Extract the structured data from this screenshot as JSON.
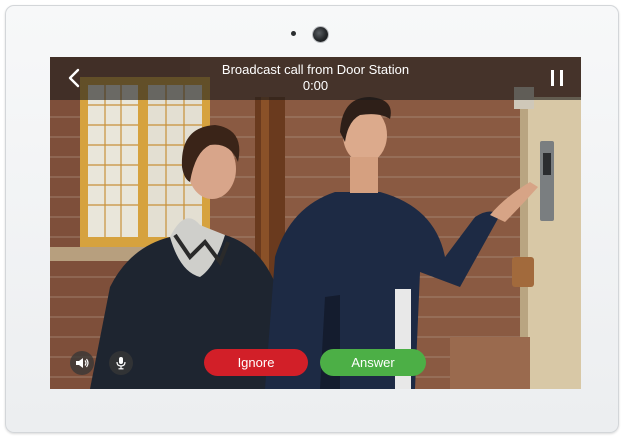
{
  "call": {
    "title": "Broadcast call from Door Station",
    "timer": "0:00"
  },
  "actions": {
    "ignore_label": "Ignore",
    "answer_label": "Answer"
  },
  "icons": {
    "back": "chevron-left-icon",
    "pause": "pause-icon",
    "speaker": "speaker-icon",
    "mic": "microphone-icon"
  },
  "colors": {
    "ignore": "#d21f28",
    "answer": "#4caf46",
    "bar_overlay": "rgba(28,28,28,0.62)"
  }
}
